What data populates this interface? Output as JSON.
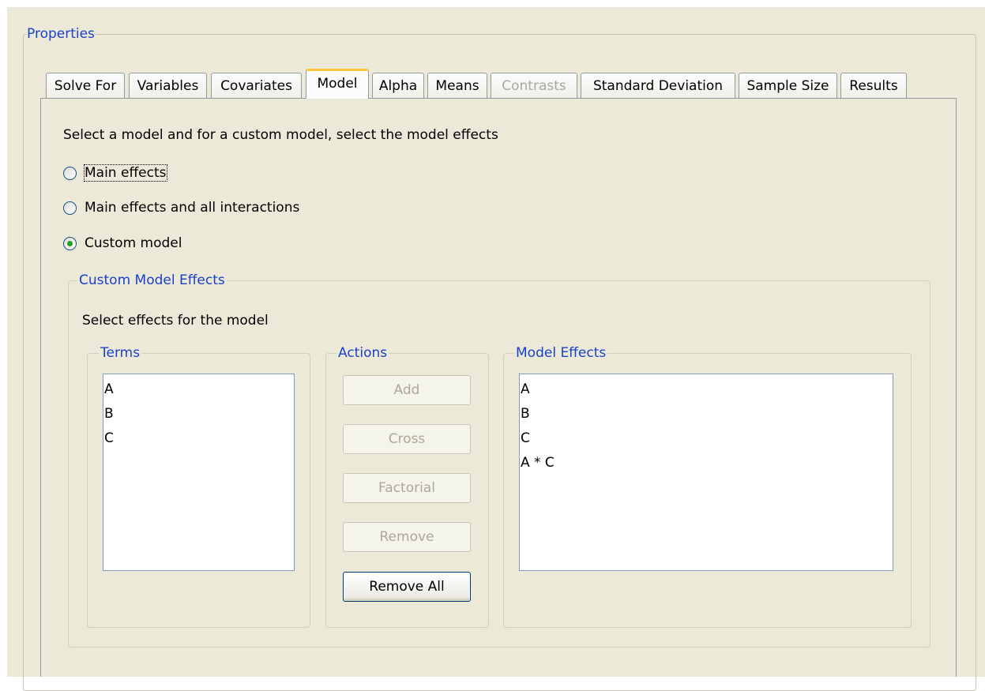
{
  "properties": {
    "title": "Properties"
  },
  "tabs": [
    {
      "label": "Solve For"
    },
    {
      "label": "Variables"
    },
    {
      "label": "Covariates"
    },
    {
      "label": "Model"
    },
    {
      "label": "Alpha"
    },
    {
      "label": "Means"
    },
    {
      "label": "Contrasts"
    },
    {
      "label": "Standard Deviation"
    },
    {
      "label": "Sample Size"
    },
    {
      "label": "Results"
    }
  ],
  "model_tab": {
    "instruction": "Select a model and for a custom model, select the model effects",
    "options": [
      {
        "label": "Main effects",
        "checked": false
      },
      {
        "label": "Main effects and all interactions",
        "checked": false
      },
      {
        "label": "Custom model",
        "checked": true
      }
    ],
    "custom_model_effects": {
      "title": "Custom Model Effects",
      "instruction": "Select effects for the model",
      "terms": {
        "title": "Terms",
        "items": [
          "A",
          "B",
          "C"
        ]
      },
      "actions": {
        "title": "Actions",
        "add": "Add",
        "cross": "Cross",
        "factorial": "Factorial",
        "remove": "Remove",
        "remove_all": "Remove All"
      },
      "model_effects": {
        "title": "Model Effects",
        "items": [
          "A",
          "B",
          "C",
          "A * C"
        ]
      }
    }
  }
}
